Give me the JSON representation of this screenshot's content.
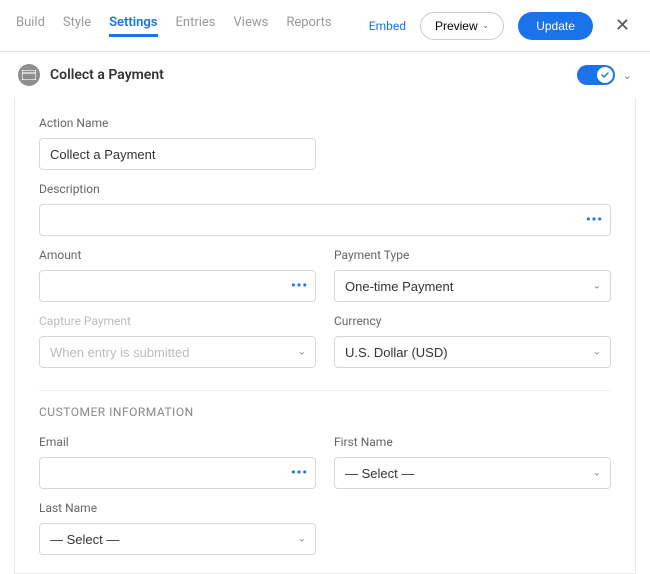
{
  "tabs": {
    "build": "Build",
    "style": "Style",
    "settings": "Settings",
    "entries": "Entries",
    "views": "Views",
    "reports": "Reports"
  },
  "actions": {
    "embed": "Embed",
    "preview": "Preview",
    "update": "Update"
  },
  "header": {
    "title": "Collect a Payment"
  },
  "form": {
    "actionName": {
      "label": "Action Name",
      "value": "Collect a Payment"
    },
    "description": {
      "label": "Description",
      "value": ""
    },
    "amount": {
      "label": "Amount",
      "value": ""
    },
    "paymentType": {
      "label": "Payment Type",
      "value": "One-time Payment"
    },
    "capturePayment": {
      "label": "Capture Payment",
      "placeholder": "When entry is submitted"
    },
    "currency": {
      "label": "Currency",
      "value": "U.S. Dollar (USD)"
    },
    "sectionTitle": "CUSTOMER INFORMATION",
    "email": {
      "label": "Email",
      "value": ""
    },
    "firstName": {
      "label": "First Name",
      "value": "— Select —"
    },
    "lastName": {
      "label": "Last Name",
      "value": "— Select —"
    }
  }
}
